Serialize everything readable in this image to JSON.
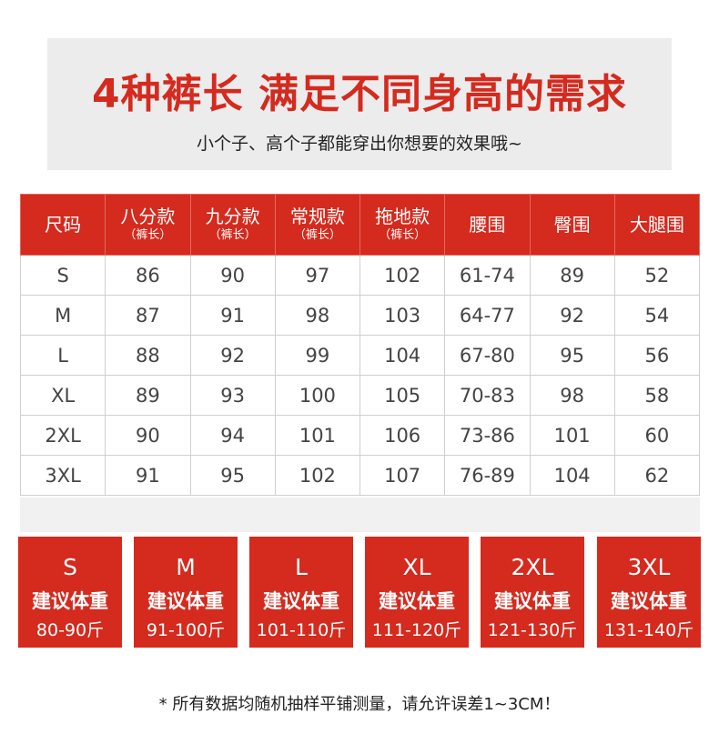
{
  "header": {
    "title": "4种裤长 满足不同身高的需求",
    "subtitle": "小个子、高个子都能穿出你想要的效果哦~"
  },
  "table": {
    "columns": [
      {
        "label": "尺码",
        "sub": ""
      },
      {
        "label": "八分款",
        "sub": "（裤长）"
      },
      {
        "label": "九分款",
        "sub": "（裤长）"
      },
      {
        "label": "常规款",
        "sub": "（裤长）"
      },
      {
        "label": "拖地款",
        "sub": "（裤长）"
      },
      {
        "label": "腰围",
        "sub": ""
      },
      {
        "label": "臀围",
        "sub": ""
      },
      {
        "label": "大腿围",
        "sub": ""
      }
    ],
    "rows": [
      [
        "S",
        "86",
        "90",
        "97",
        "102",
        "61-74",
        "89",
        "52"
      ],
      [
        "M",
        "87",
        "91",
        "98",
        "103",
        "64-77",
        "92",
        "54"
      ],
      [
        "L",
        "88",
        "92",
        "99",
        "104",
        "67-80",
        "95",
        "56"
      ],
      [
        "XL",
        "89",
        "93",
        "100",
        "105",
        "70-83",
        "98",
        "58"
      ],
      [
        "2XL",
        "90",
        "94",
        "101",
        "106",
        "73-86",
        "101",
        "60"
      ],
      [
        "3XL",
        "91",
        "95",
        "102",
        "107",
        "76-89",
        "104",
        "62"
      ]
    ]
  },
  "weight_cards": [
    {
      "size": "S",
      "label": "建议体重",
      "range": "80-90斤"
    },
    {
      "size": "M",
      "label": "建议体重",
      "range": "91-100斤"
    },
    {
      "size": "L",
      "label": "建议体重",
      "range": "101-110斤"
    },
    {
      "size": "XL",
      "label": "建议体重",
      "range": "111-120斤"
    },
    {
      "size": "2XL",
      "label": "建议体重",
      "range": "121-130斤"
    },
    {
      "size": "3XL",
      "label": "建议体重",
      "range": "131-140斤"
    }
  ],
  "footnote": "* 所有数据均随机抽样平铺测量，请允许误差1~3CM！",
  "colors": {
    "accent": "#d52a1e",
    "header_bg": "#ececec",
    "text": "#444444"
  }
}
